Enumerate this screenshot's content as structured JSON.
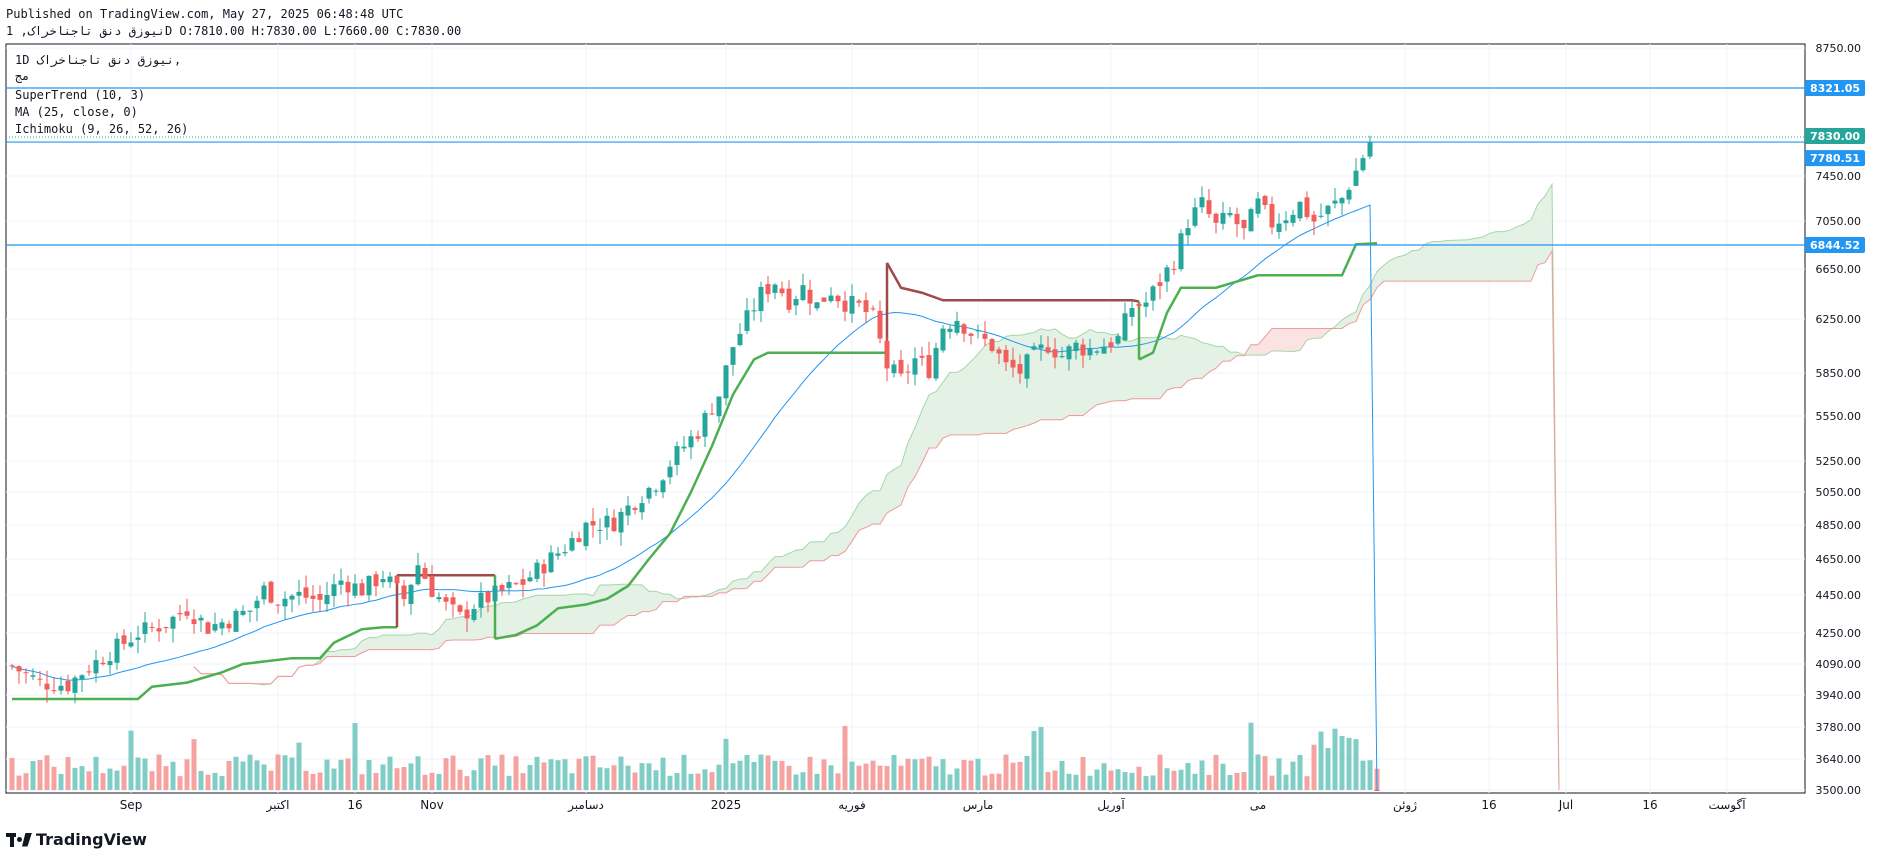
{
  "header": {
    "published": "Published on TradingView.com, May 27, 2025 06:48:48 UTC",
    "symbol_line": "نیوزق دنق  تاجناخراک, 1D O:7810.00 H:7830.00 L:7660.00 C:7830.00"
  },
  "legend": {
    "symbol": "1D  نیوزق دنق  تاجناخراک,",
    "symbol2": "مج",
    "supertrend": "SuperTrend (10, 3)",
    "ma": "MA (25, close, 0)",
    "ichimoku": "Ichimoku (9, 26, 52, 26)"
  },
  "brand": {
    "name": "TradingView",
    "icon": "tradingview-logo-icon"
  },
  "colors": {
    "up": "#26a69a",
    "down": "#ef5350",
    "up_body": "#26a69a",
    "down_body": "#f05f5c",
    "ma": "#2196f3",
    "supertrend_up": "#4caf50",
    "supertrend_down": "#a04a4a",
    "cloud_green": "#e3f2e5",
    "cloud_red": "#fbe3e3",
    "hline": "#2196f3",
    "vol_up": "#7fcdc4",
    "vol_down": "#f4a3a1"
  },
  "chart_data": {
    "type": "candlestick",
    "title": "",
    "ylim": [
      3500,
      8750
    ],
    "y_ticks": [
      "8750.00",
      "7450.00",
      "7050.00",
      "6650.00",
      "6250.00",
      "5850.00",
      "5550.00",
      "5250.00",
      "5050.00",
      "4850.00",
      "4650.00",
      "4450.00",
      "4250.00",
      "4090.00",
      "3940.00",
      "3780.00",
      "3640.00",
      "3500.00"
    ],
    "y_tick_values": [
      8750,
      7450,
      7050,
      6650,
      6250,
      5850,
      5550,
      5250,
      5050,
      4850,
      4650,
      4450,
      4250,
      4090,
      3940,
      3780,
      3640,
      3500
    ],
    "x_labels": [
      {
        "label": "Sep",
        "idx": 17
      },
      {
        "label": "اکتبر",
        "idx": 38
      },
      {
        "label": "16",
        "idx": 49
      },
      {
        "label": "Nov",
        "idx": 60
      },
      {
        "label": "دسامبر",
        "idx": 82
      },
      {
        "label": "2025",
        "idx": 102
      },
      {
        "label": "فوریه",
        "idx": 120
      },
      {
        "label": "مارس",
        "idx": 138
      },
      {
        "label": "آوریل",
        "idx": 157
      },
      {
        "label": "می",
        "idx": 178
      },
      {
        "label": "ژوئن",
        "idx": 199
      },
      {
        "label": "16",
        "idx": 211
      },
      {
        "label": "Jul",
        "idx": 222
      },
      {
        "label": "16",
        "idx": 234
      },
      {
        "label": "آگوست",
        "idx": 245
      }
    ],
    "price_labels": [
      {
        "value": 8321.05,
        "text": "8321.05",
        "color": "#2196f3"
      },
      {
        "value": 7830.0,
        "text": "7830.00",
        "color": "#26a69a"
      },
      {
        "value": 7780.51,
        "text": "7780.51",
        "color": "#2196f3"
      },
      {
        "value": 6844.52,
        "text": "6844.52",
        "color": "#2196f3"
      }
    ],
    "horizontal_lines": [
      8321.05,
      7780.51,
      6844.52
    ],
    "last": {
      "open": 7810.0,
      "high": 7830.0,
      "low": 7660.0,
      "close": 7830.0
    }
  }
}
